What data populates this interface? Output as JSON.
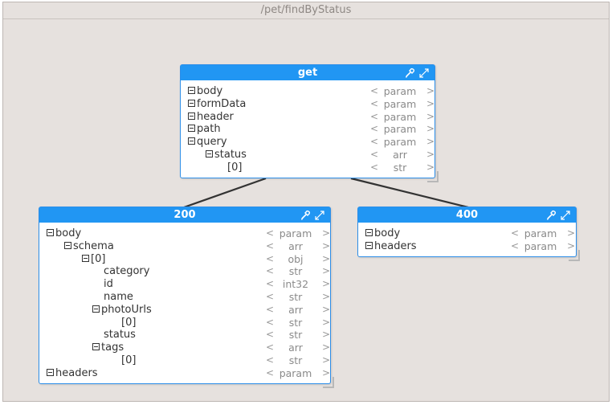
{
  "window": {
    "title": "/pet/findByStatus"
  },
  "nodes": {
    "get": {
      "title": "get",
      "rows": [
        {
          "label": "body",
          "type": "param"
        },
        {
          "label": "formData",
          "type": "param"
        },
        {
          "label": "header",
          "type": "param"
        },
        {
          "label": "path",
          "type": "param"
        },
        {
          "label": "query",
          "type": "param"
        },
        {
          "label": "status",
          "type": "arr"
        },
        {
          "label": "[0]",
          "type": "str"
        }
      ]
    },
    "r200": {
      "title": "200",
      "rows": [
        {
          "label": "body",
          "type": "param"
        },
        {
          "label": "schema",
          "type": "arr"
        },
        {
          "label": "[0]",
          "type": "obj"
        },
        {
          "label": "category",
          "type": "str"
        },
        {
          "label": "id",
          "type": "int32"
        },
        {
          "label": "name",
          "type": "str"
        },
        {
          "label": "photoUrls",
          "type": "arr"
        },
        {
          "label": "[0]",
          "type": "str"
        },
        {
          "label": "status",
          "type": "str"
        },
        {
          "label": "tags",
          "type": "arr"
        },
        {
          "label": "[0]",
          "type": "str"
        },
        {
          "label": "headers",
          "type": "param"
        }
      ]
    },
    "r400": {
      "title": "400",
      "rows": [
        {
          "label": "body",
          "type": "param"
        },
        {
          "label": "headers",
          "type": "param"
        }
      ]
    }
  },
  "symbols": {
    "open": "<",
    "close": ">"
  },
  "colors": {
    "header": "#2196f3",
    "link": "#333333",
    "background": "#e6e1de"
  },
  "icons": {
    "pin": "eyedropper-icon",
    "expand": "expand-icon"
  }
}
